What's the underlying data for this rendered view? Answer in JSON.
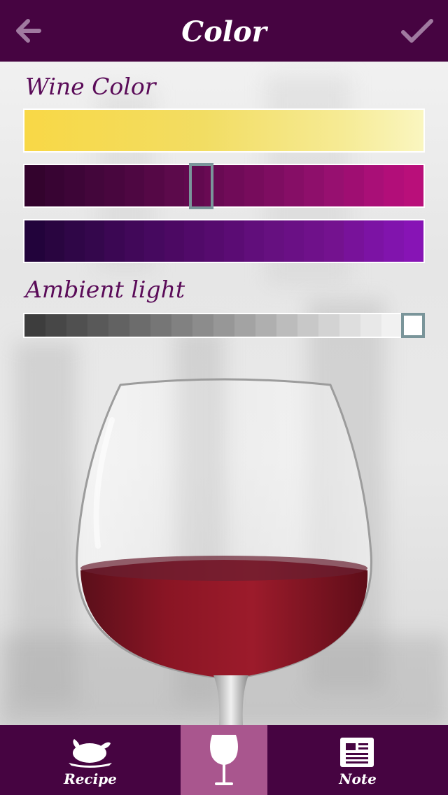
{
  "header": {
    "title": "Color",
    "back_icon": "arrow-left-icon",
    "done_icon": "checkmark-icon",
    "color": "#460441"
  },
  "wine_color": {
    "label": "Wine Color",
    "rows": [
      {
        "name": "yellow",
        "colors": []
      },
      {
        "name": "red-magenta",
        "colors": [
          "#33032d",
          "#380433",
          "#3d0537",
          "#43063b",
          "#48063e",
          "#4e0742",
          "#550846",
          "#5c0a4b",
          "#62094f",
          "#690a53",
          "#700b58",
          "#770c5c",
          "#7e0d61",
          "#860e66",
          "#8e0f6b",
          "#971070",
          "#9f0e72",
          "#a90f77",
          "#b20e79",
          "#b90f7a"
        ],
        "selected_index": 8
      },
      {
        "name": "purple",
        "colors": [
          "#22033b",
          "#290540",
          "#2f0647",
          "#34074c",
          "#3b0753",
          "#410859",
          "#46095f",
          "#4c0963",
          "#510a69",
          "#560b6e",
          "#5b0c74",
          "#610e7b",
          "#661080",
          "#6a1085",
          "#6f118a",
          "#74128f",
          "#78129a",
          "#7c13a4",
          "#8114ad",
          "#8714b5"
        ],
        "selected_index": null
      }
    ]
  },
  "ambient_light": {
    "label": "Ambient light",
    "colors": [
      "#3d3d3d",
      "#474747",
      "#505050",
      "#595959",
      "#626262",
      "#6c6c6c",
      "#767676",
      "#818181",
      "#8c8c8c",
      "#979797",
      "#a3a3a3",
      "#afafaf",
      "#bcbcbc",
      "#c8c8c8",
      "#d3d3d3",
      "#dedede",
      "#e8e8e8",
      "#f1f1f1",
      "#f8f8f8"
    ],
    "selected_index": 18
  },
  "tabs": [
    {
      "id": "recipe",
      "label": "Recipe",
      "icon": "roast-turkey-icon",
      "active": false
    },
    {
      "id": "glass",
      "label": "",
      "icon": "wine-glass-icon",
      "active": true
    },
    {
      "id": "note",
      "label": "Note",
      "icon": "notepad-icon",
      "active": false
    }
  ],
  "colors": {
    "brand_dark": "#460441",
    "tab_active": "#a9568e",
    "label_text": "#5a0b58",
    "selector_border": "#7a959a",
    "wine_red": "#8a1524"
  }
}
